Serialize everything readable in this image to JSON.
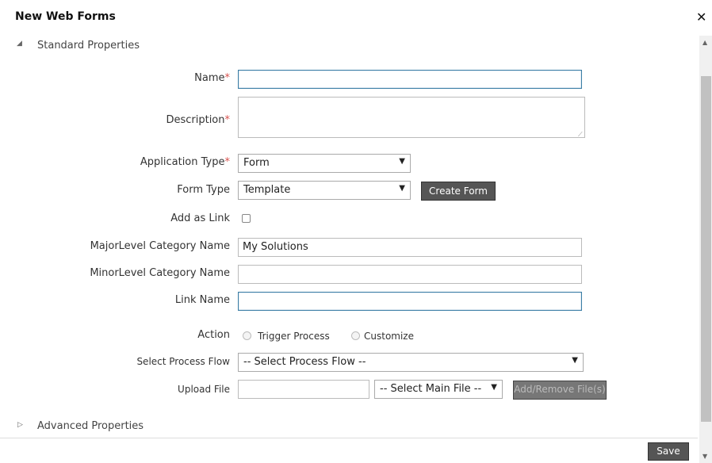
{
  "window": {
    "title": "New Web Forms"
  },
  "sections": {
    "standard": {
      "label": "Standard Properties"
    },
    "advanced": {
      "label": "Advanced Properties"
    }
  },
  "form": {
    "name": {
      "label": "Name",
      "required": "*",
      "value": ""
    },
    "description": {
      "label": "Description",
      "required": "*",
      "value": ""
    },
    "application_type": {
      "label": "Application Type",
      "required": "*",
      "value": "Form"
    },
    "form_type": {
      "label": "Form Type",
      "value": "Template",
      "button": "Create Form"
    },
    "add_as_link": {
      "label": "Add as Link",
      "checked": false
    },
    "major_category": {
      "label": "MajorLevel Category Name",
      "value": "My Solutions"
    },
    "minor_category": {
      "label": "MinorLevel Category Name",
      "value": ""
    },
    "link_name": {
      "label": "Link Name",
      "value": ""
    },
    "action": {
      "label": "Action",
      "options": [
        "Trigger Process",
        "Customize"
      ]
    },
    "process_flow": {
      "label": "Select Process Flow",
      "value": "-- Select Process Flow --"
    },
    "upload": {
      "label": "Upload File",
      "value": "",
      "main_file": "-- Select Main File --",
      "button": "Add/Remove File(s)"
    }
  },
  "footer": {
    "save_label": "Save"
  },
  "icons": {
    "close": "close-icon",
    "expanded": "triangle-expanded-icon",
    "collapsed": "triangle-collapsed-icon",
    "dropdown": "chevron-down-icon"
  },
  "colors": {
    "button_dark": "#555555",
    "required": "#d9534f",
    "focus_border": "#3d7fa6"
  }
}
